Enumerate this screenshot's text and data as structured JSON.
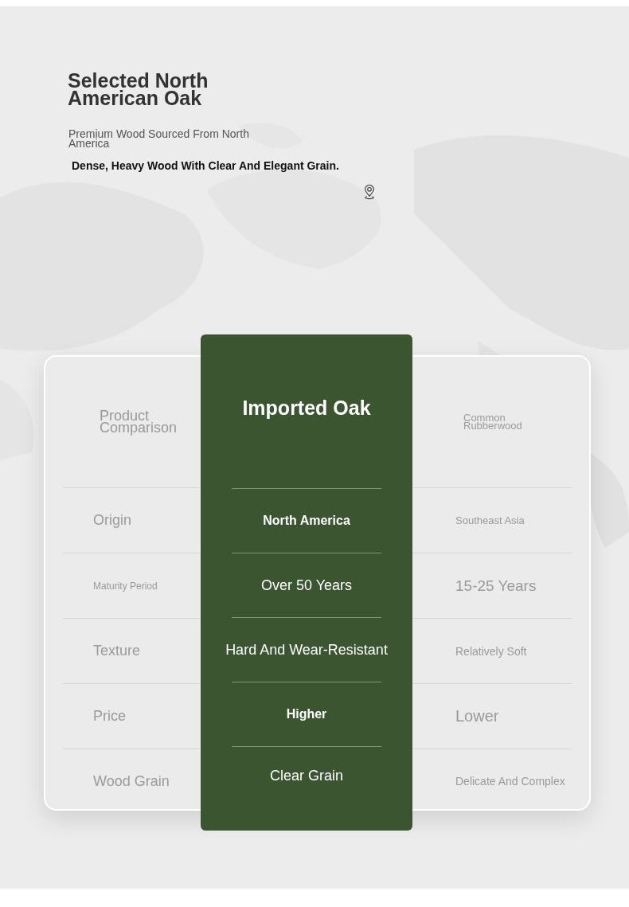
{
  "hero": {
    "title": "Selected North American Oak",
    "subtitle": "Premium Wood Sourced From North America",
    "description": "Dense, Heavy Wood With Clear And Elegant Grain."
  },
  "comparison": {
    "header": {
      "label": "Product Comparison",
      "featured": "Imported Oak",
      "other": "Common Rubberwood"
    },
    "rows": [
      {
        "attribute": "Origin",
        "featured": "North America",
        "other": "Southeast Asia"
      },
      {
        "attribute": "Maturity Period",
        "featured": "Over 50 Years",
        "other": "15-25 Years"
      },
      {
        "attribute": "Texture",
        "featured": "Hard And Wear-Resistant",
        "other": "Relatively Soft"
      },
      {
        "attribute": "Price",
        "featured": "Higher",
        "other": "Lower"
      },
      {
        "attribute": "Wood Grain",
        "featured": "Clear Grain",
        "other": "Delicate And Complex"
      }
    ]
  }
}
